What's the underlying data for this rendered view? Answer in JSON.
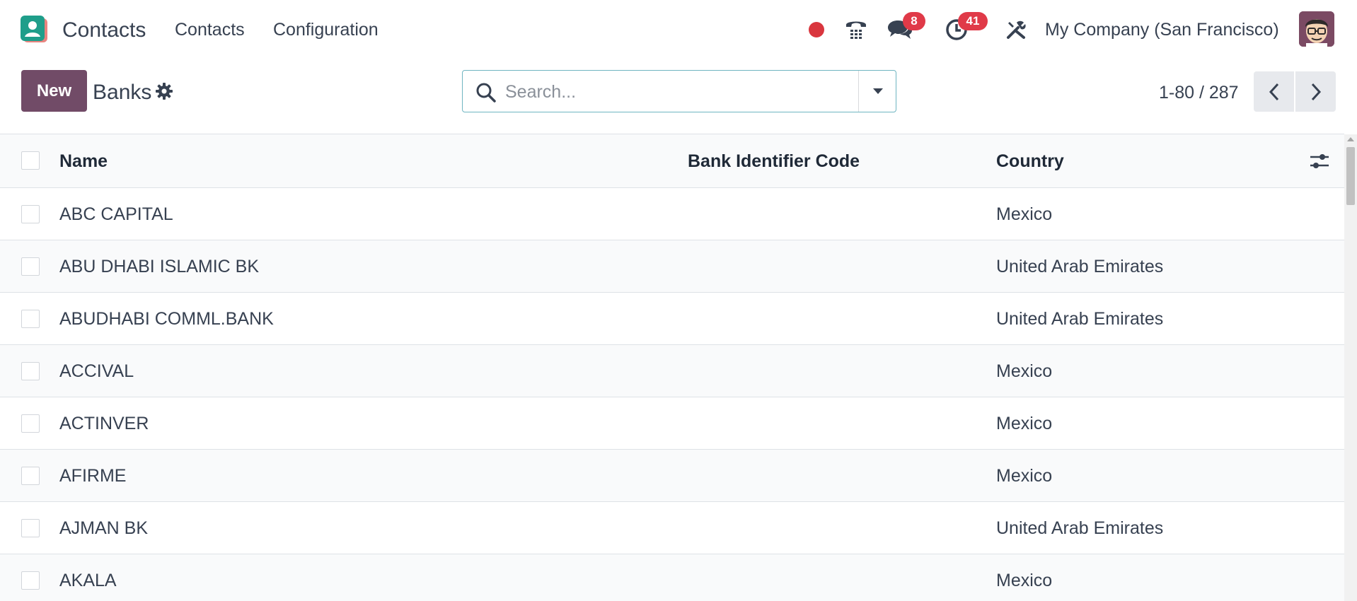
{
  "navbar": {
    "app_name": "Contacts",
    "menus": [
      "Contacts",
      "Configuration"
    ],
    "chat_badge": "8",
    "activity_badge": "41",
    "company": "My Company (San Francisco)"
  },
  "control_panel": {
    "new_label": "New",
    "title": "Banks",
    "search_placeholder": "Search...",
    "pager": "1-80 / 287"
  },
  "list": {
    "columns": [
      "Name",
      "Bank Identifier Code",
      "Country"
    ],
    "rows": [
      {
        "name": "ABC CAPITAL",
        "bic": "",
        "country": "Mexico"
      },
      {
        "name": "ABU DHABI ISLAMIC BK",
        "bic": "",
        "country": "United Arab Emirates"
      },
      {
        "name": "ABUDHABI COMML.BANK",
        "bic": "",
        "country": "United Arab Emirates"
      },
      {
        "name": "ACCIVAL",
        "bic": "",
        "country": "Mexico"
      },
      {
        "name": "ACTINVER",
        "bic": "",
        "country": "Mexico"
      },
      {
        "name": "AFIRME",
        "bic": "",
        "country": "Mexico"
      },
      {
        "name": "AJMAN BK",
        "bic": "",
        "country": "United Arab Emirates"
      },
      {
        "name": "AKALA",
        "bic": "",
        "country": "Mexico"
      }
    ]
  },
  "icons": {
    "app": "contacts-app-icon",
    "recording": "recording-dot-icon",
    "phone": "phone-icon",
    "chat": "chat-bubbles-icon",
    "activity": "clock-icon",
    "debug": "tools-icon",
    "gear": "gear-icon",
    "search": "search-icon",
    "dropdown": "caret-down-icon",
    "prev": "chevron-left-icon",
    "next": "chevron-right-icon",
    "optional_columns": "sliders-icon"
  },
  "colors": {
    "brand": "#714b67",
    "badge": "#e03a48",
    "record": "#d9363e",
    "search_border": "#6fb5c1"
  }
}
